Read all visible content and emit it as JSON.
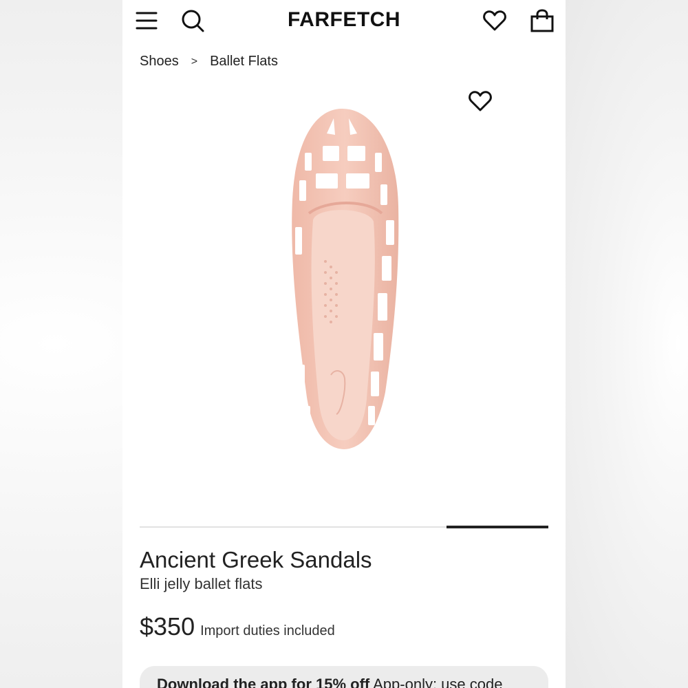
{
  "header": {
    "logo": "FARFETCH",
    "icons": [
      "menu-icon",
      "search-icon",
      "heart-icon",
      "bag-icon"
    ]
  },
  "breadcrumb": {
    "items": [
      "Shoes",
      "Ballet Flats"
    ],
    "separator": ">"
  },
  "gallery": {
    "image_alt_icon": "shoe-image",
    "wishlist_icon": "heart-outline-icon",
    "progress": {
      "current_slide": 4,
      "total_slides": 4,
      "fraction_filled": 0.25
    }
  },
  "product": {
    "brand": "Ancient Greek Sandals",
    "name": "Elli jelly ballet flats",
    "price": "$350",
    "duties_note": "Import duties included"
  },
  "promo": {
    "bold_text": "Download the app for 15% off",
    "text": " App-only: use code"
  },
  "colors": {
    "shoe": "#f1c1b3",
    "accent": "#222222",
    "promo_bg": "#ececec"
  }
}
